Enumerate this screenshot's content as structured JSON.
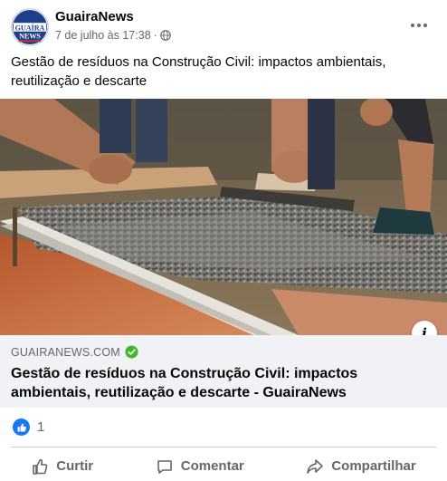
{
  "post": {
    "page_name": "GuairaNews",
    "avatar_text": [
      "GUAÍRA",
      "NEWS"
    ],
    "date": "7 de julho às 17:38",
    "separator": "·",
    "text": "Gestão de resíduos na Construção Civil: impactos ambientais, reutilização e descarte"
  },
  "link": {
    "domain": "GUAIRANEWS.COM",
    "title": "Gestão de resíduos na Construção Civil: impactos ambientais, reutilização e descarte - GuairaNews",
    "info_label": "i"
  },
  "reactions": {
    "count": "1"
  },
  "actions": {
    "like": "Curtir",
    "comment": "Comentar",
    "share": "Compartilhar"
  },
  "colors": {
    "accent": "#1877f2",
    "secondary_text": "#65676b",
    "link_background": "#f0f2f5",
    "verified": "#42b72a"
  },
  "icons": [
    "globe-icon",
    "more-icon",
    "info-icon",
    "verified-icon",
    "like-reaction-icon",
    "like-icon",
    "comment-icon",
    "share-icon"
  ]
}
